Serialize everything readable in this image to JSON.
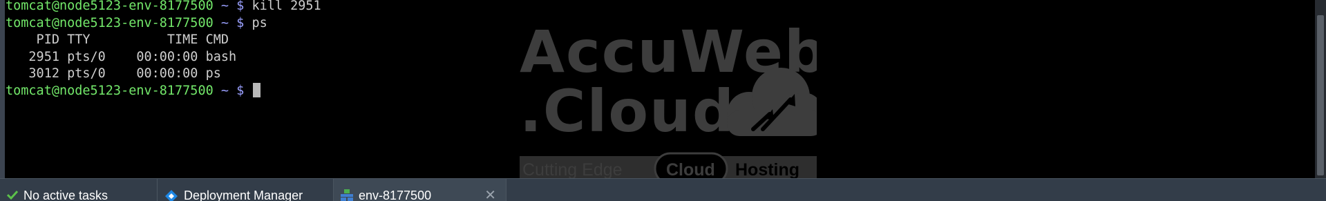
{
  "terminal": {
    "lines": [
      {
        "user": "tomcat@node5123-env-8177500",
        "tilde": "~",
        "dollar": "$",
        "command": "kill 2951"
      },
      {
        "user": "tomcat@node5123-env-8177500",
        "tilde": "~",
        "dollar": "$",
        "command": "ps"
      },
      {
        "output": "    PID TTY          TIME CMD"
      },
      {
        "output": "   2951 pts/0    00:00:00 bash"
      },
      {
        "output": "   3012 pts/0    00:00:00 ps"
      },
      {
        "user": "tomcat@node5123-env-8177500",
        "tilde": "~",
        "dollar": "$",
        "command": ""
      }
    ]
  },
  "watermark": {
    "line1": "AccuWeb",
    "line2": ".Cloud",
    "tag_left": "Cutting Edge",
    "tag_mid": "Cloud",
    "tag_right": "Hosting"
  },
  "taskbar": {
    "tabs": [
      {
        "label": "No active tasks",
        "icon": "check-icon"
      },
      {
        "label": "Deployment Manager",
        "icon": "deployment-icon"
      },
      {
        "label": "env-8177500",
        "icon": "environment-icon",
        "close": "✕"
      }
    ]
  },
  "colors": {
    "prompt_user": "#73e86a",
    "prompt_symbol": "#9aa0ff",
    "text": "#cfcfcf",
    "taskbar_bg": "#333d49",
    "check": "#5cc14a",
    "deploy_icon": "#1e88e5"
  }
}
